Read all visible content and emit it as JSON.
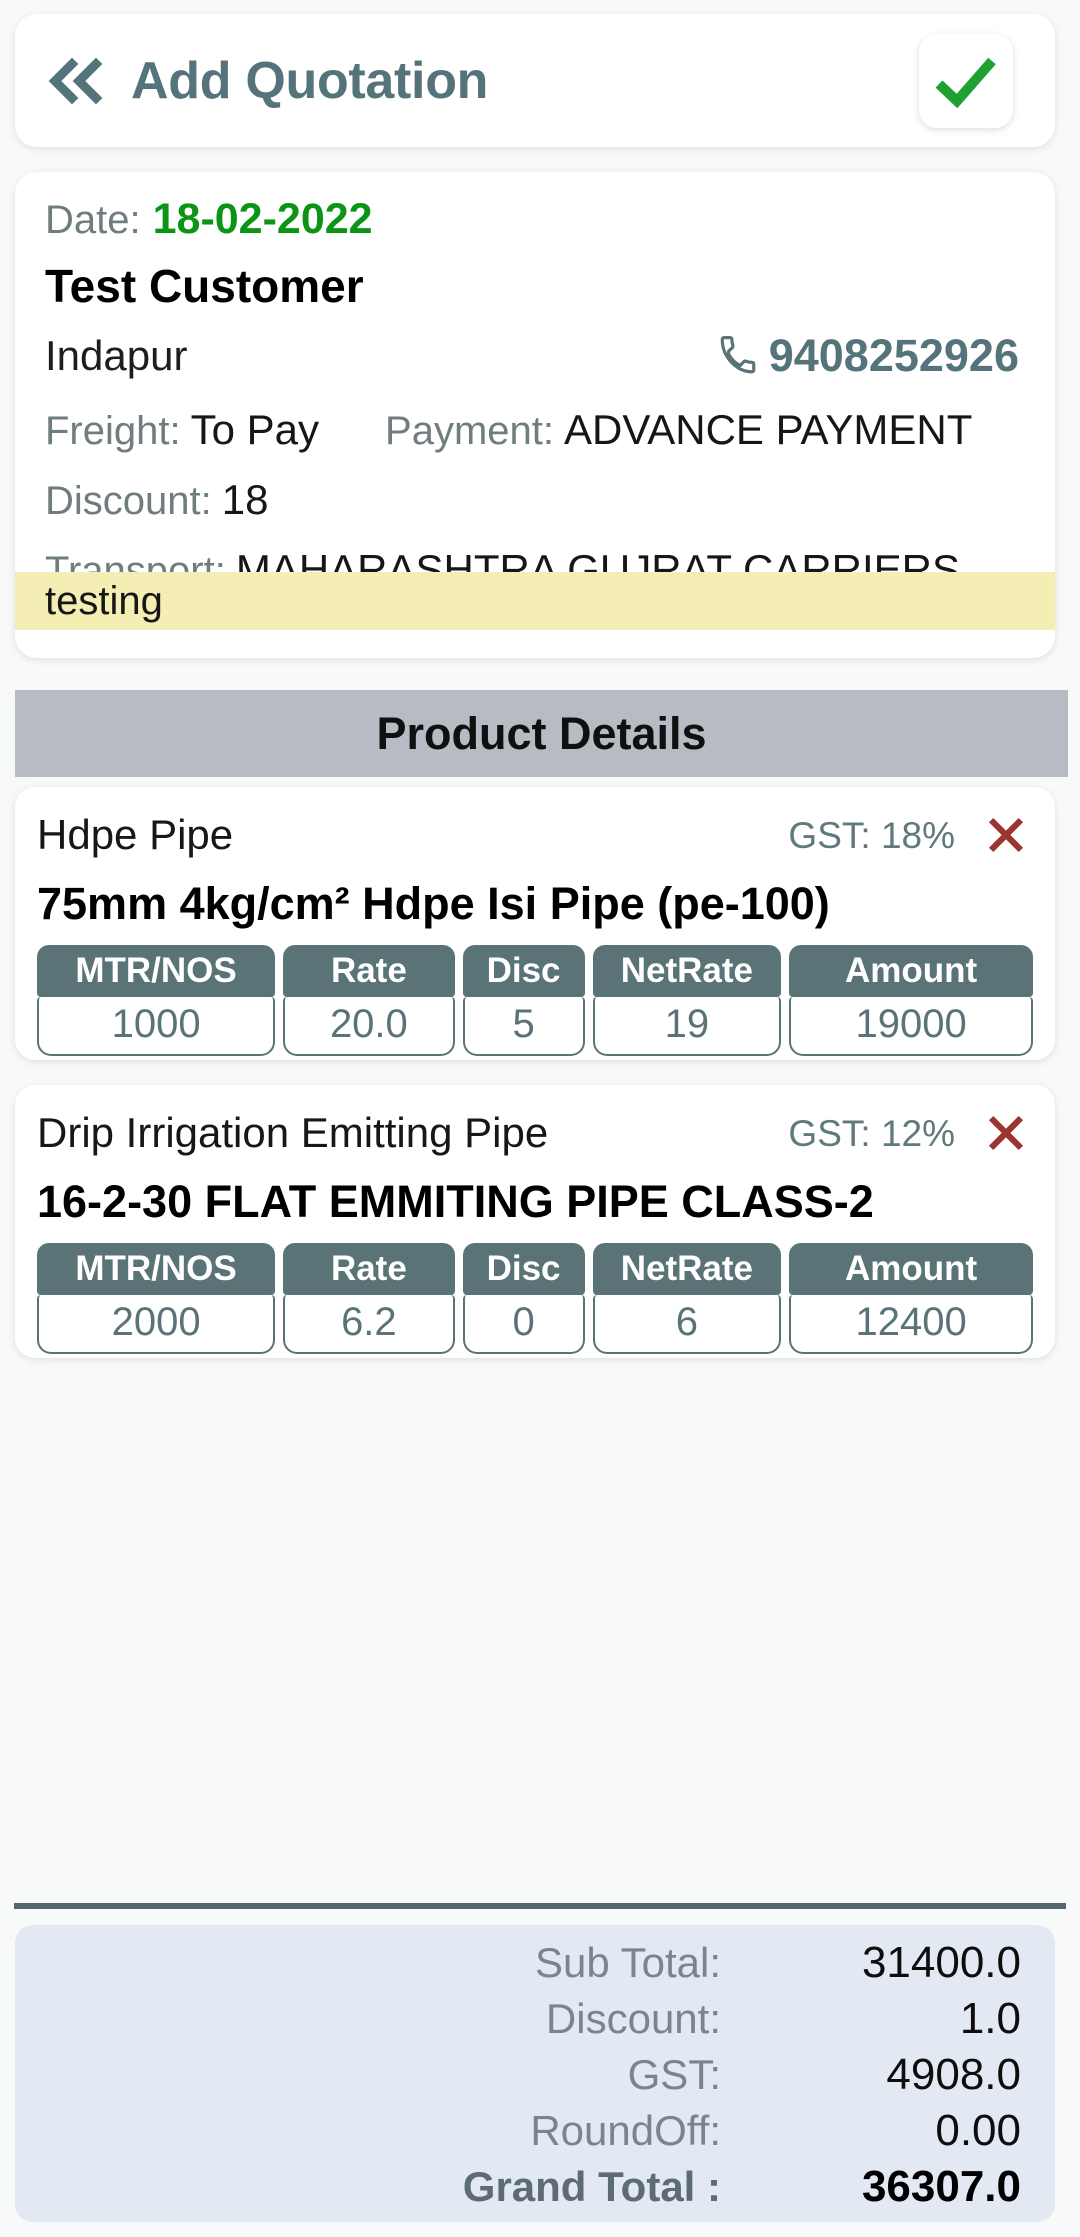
{
  "header": {
    "back_icon": "double-chevron-left-icon",
    "title": "Add Quotation",
    "confirm_icon": "check-icon",
    "title_color": "#54737a",
    "confirm_color": "#20a030"
  },
  "customer": {
    "date_label": "Date:",
    "date_value": "18-02-2022",
    "date_color": "#0c9415",
    "name": "Test Customer",
    "address": "Indapur",
    "phone_icon": "phone-icon",
    "phone": "9408252926",
    "freight_label": "Freight:",
    "freight_value": "To Pay",
    "payment_label": "Payment:",
    "payment_value": "ADVANCE PAYMENT",
    "discount_label": "Discount:",
    "discount_value": "18",
    "transport_label": "Transport:",
    "transport_value": "MAHARASHTRA GUJRAT CARRIERS",
    "note": "testing",
    "note_bg": "#f4eeb5"
  },
  "section": {
    "product_details_title": "Product Details",
    "bar_color": "#b7bcc4"
  },
  "table": {
    "columns": [
      "MTR/NOS",
      "Rate",
      "Disc",
      "NetRate",
      "Amount"
    ],
    "header_bg": "#5a7377",
    "value_color": "#5a7377"
  },
  "products": [
    {
      "category": "Hdpe Pipe",
      "gst": "GST: 18%",
      "delete_icon": "close-x-icon",
      "name": "75mm 4kg/cm² Hdpe Isi Pipe (pe-100)",
      "values": [
        "1000",
        "20.0",
        "5",
        "19",
        "19000"
      ]
    },
    {
      "category": "Drip Irrigation Emitting Pipe",
      "gst": "GST: 12%",
      "delete_icon": "close-x-icon",
      "name": "16-2-30 FLAT EMMITING PIPE CLASS-2",
      "values": [
        "2000",
        "6.2",
        "0",
        "6",
        "12400"
      ]
    }
  ],
  "totals": {
    "bg": "#e3e9f3",
    "rows": [
      {
        "label": "Sub Total:",
        "value": "31400.0"
      },
      {
        "label": "Discount:",
        "value": "1.0"
      },
      {
        "label": "GST:",
        "value": "4908.0"
      },
      {
        "label": "RoundOff:",
        "value": "0.00"
      }
    ],
    "grand": {
      "label": "Grand Total :",
      "value": "36307.0"
    }
  }
}
